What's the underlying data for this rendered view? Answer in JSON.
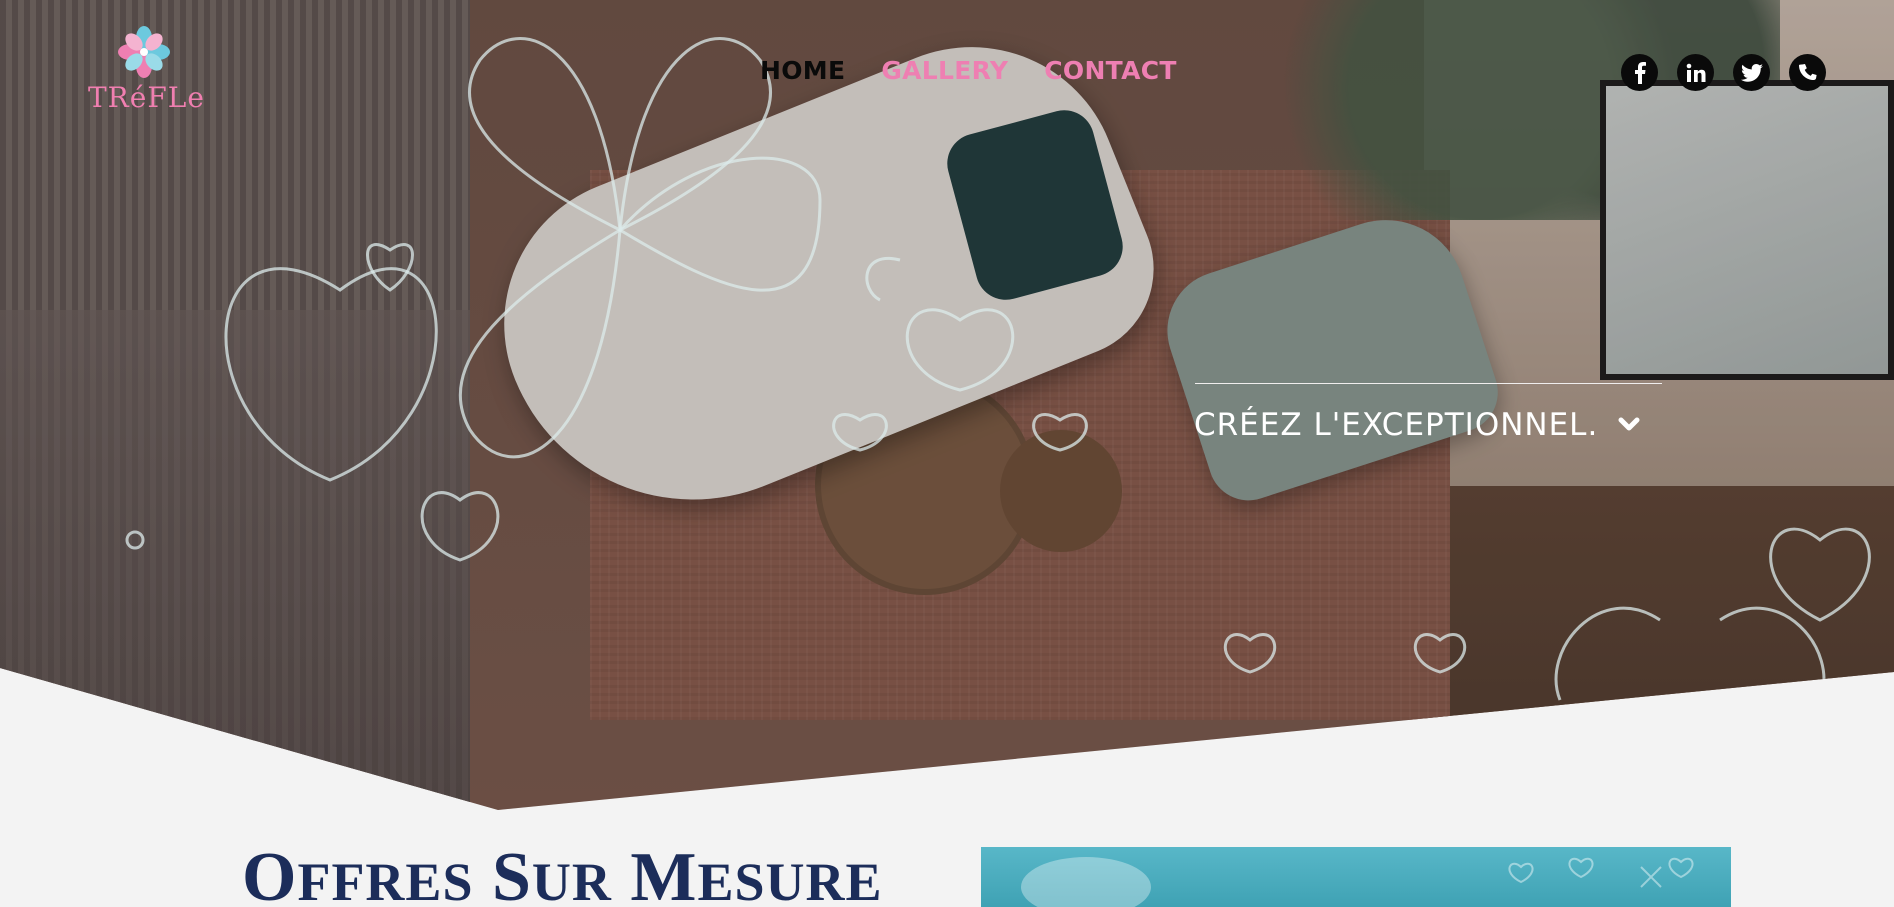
{
  "brand": {
    "name": "TRéFLe",
    "colors": {
      "pink": "#ee7fb2",
      "blue": "#6cc9de",
      "navy": "#1c2d5a"
    },
    "logo_icon": "clover-flower-icon"
  },
  "nav": {
    "items": [
      {
        "label": "HOME",
        "active": true
      },
      {
        "label": "GALLERY",
        "active": false
      },
      {
        "label": "CONTACT",
        "active": false
      }
    ]
  },
  "social": [
    {
      "icon": "facebook-icon",
      "glyph": "f"
    },
    {
      "icon": "linkedin-icon",
      "glyph": "in"
    },
    {
      "icon": "twitter-icon",
      "glyph": "t"
    },
    {
      "icon": "phone-icon",
      "glyph": "☎"
    }
  ],
  "hero": {
    "tagline": "CRÉEZ L'EXCEPTIONNEL.",
    "tagline_icon": "chevron-down-icon",
    "image": "overhead-living-room-render"
  },
  "offers": {
    "title_parts": [
      "O",
      "ffres",
      " S",
      "ur",
      " M",
      "esure"
    ]
  }
}
